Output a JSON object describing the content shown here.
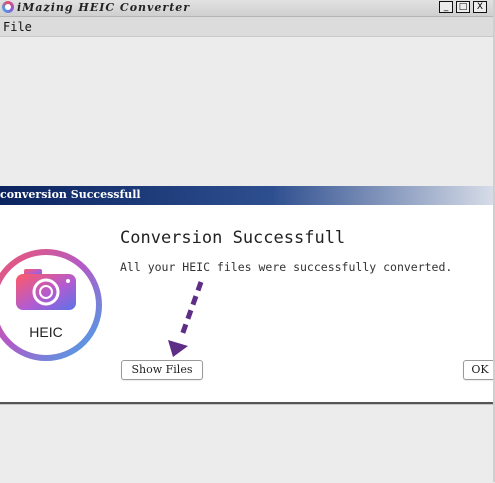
{
  "main_window": {
    "title": "iMazing HEIC Converter",
    "controls": {
      "minimize": "_",
      "maximize": "□",
      "close": "X"
    }
  },
  "menubar": {
    "file": "File"
  },
  "dialog": {
    "title": "conversion Successfull",
    "heading": "Conversion Successfull",
    "message": "All your HEIC files were successfully converted.",
    "logo_text": "HEIC",
    "buttons": {
      "show_files": "Show Files",
      "ok": "OK"
    }
  },
  "colors": {
    "dialog_title_start": "#0b2460",
    "arrow": "#5e2d86",
    "logo_ring_pink": "#e94b6c",
    "logo_ring_blue": "#4aa3e8"
  },
  "icons": [
    "app-icon",
    "heic-camera-icon",
    "arrow-annotation"
  ]
}
